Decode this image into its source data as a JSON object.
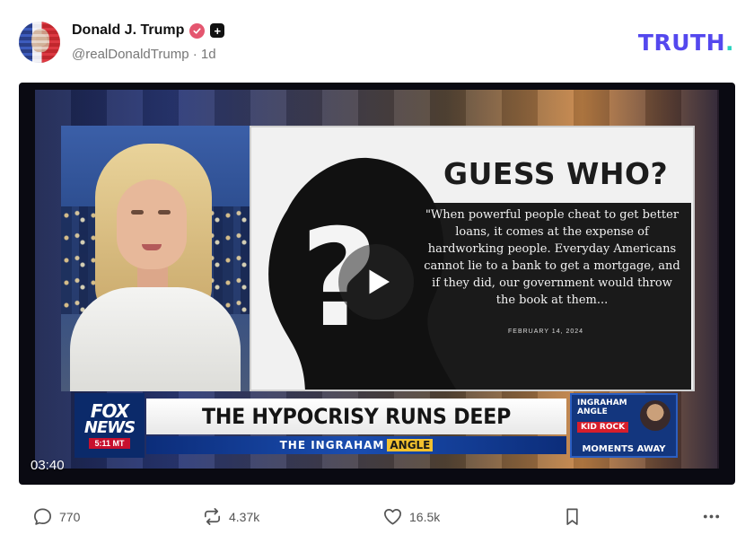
{
  "post": {
    "author": {
      "display_name": "Donald J. Trump",
      "handle": "@realDonaldTrump",
      "separator": "·",
      "time_ago": "1d",
      "verified_color": "#e4566f"
    },
    "brand": {
      "logo_text": "TRUTH",
      "logo_dot": ".",
      "logo_color": "#5448ee",
      "dot_color": "#2ad4c0"
    },
    "video": {
      "duration": "03:40",
      "guess_title": "GUESS WHO?",
      "quote": "\"When powerful people cheat to get better loans, it comes at the expense of hardworking people. Everyday Americans cannot lie to a bank to get a mortgage, and if they did, our government would throw the book at them...",
      "quote_date": "FEBRUARY 14, 2024",
      "network_line1": "FOX",
      "network_line2": "NEWS",
      "network_time": "5:11 MT",
      "headline": "THE HYPOCRISY RUNS DEEP",
      "show_name": "THE INGRAHAM",
      "show_name_accent": "ANGLE",
      "promo_show": "INGRAHAM ANGLE",
      "promo_guest": "KID ROCK",
      "promo_timing": "MOMENTS AWAY"
    },
    "actions": {
      "replies": "770",
      "retruths": "4.37k",
      "likes": "16.5k"
    }
  }
}
